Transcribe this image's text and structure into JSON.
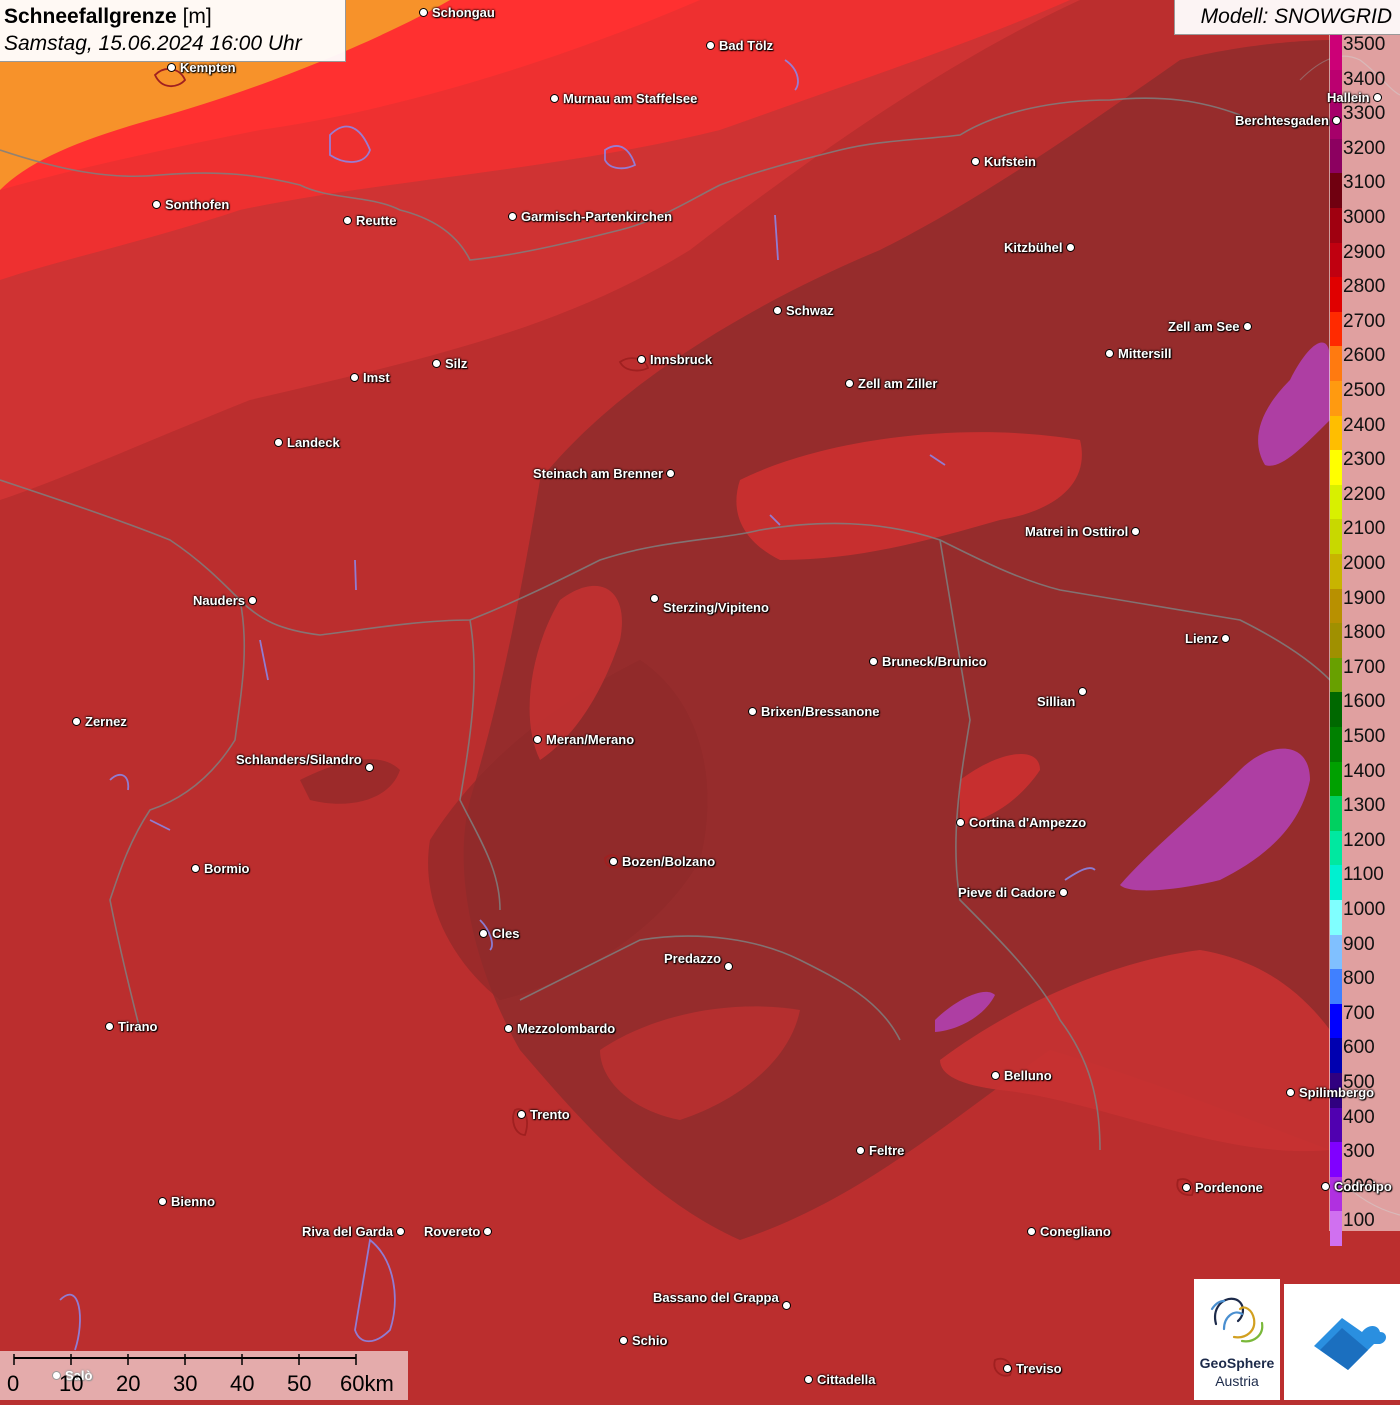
{
  "title": {
    "parameter": "Schneefallgrenze",
    "unit": "[m]",
    "datetime": "Samstag, 15.06.2024 16:00 Uhr"
  },
  "model": "Modell: SNOWGRID",
  "legend": {
    "levels": [
      {
        "label": "3500",
        "color": "#cc0077"
      },
      {
        "label": "3400",
        "color": "#bb0070"
      },
      {
        "label": "3300",
        "color": "#a6006a"
      },
      {
        "label": "3200",
        "color": "#8c0060"
      },
      {
        "label": "3100",
        "color": "#700010"
      },
      {
        "label": "3000",
        "color": "#a00010"
      },
      {
        "label": "2900",
        "color": "#c00010"
      },
      {
        "label": "2800",
        "color": "#e00000"
      },
      {
        "label": "2700",
        "color": "#ff2a00"
      },
      {
        "label": "2600",
        "color": "#ff7a10"
      },
      {
        "label": "2500",
        "color": "#ff9a10"
      },
      {
        "label": "2400",
        "color": "#ffbe00"
      },
      {
        "label": "2300",
        "color": "#ffff00"
      },
      {
        "label": "2200",
        "color": "#d8f000"
      },
      {
        "label": "2100",
        "color": "#c8d800"
      },
      {
        "label": "2000",
        "color": "#c8b400"
      },
      {
        "label": "1900",
        "color": "#b89000"
      },
      {
        "label": "1800",
        "color": "#a09000"
      },
      {
        "label": "1700",
        "color": "#68a000"
      },
      {
        "label": "1600",
        "color": "#006800"
      },
      {
        "label": "1500",
        "color": "#008000"
      },
      {
        "label": "1400",
        "color": "#00a000"
      },
      {
        "label": "1300",
        "color": "#00d060"
      },
      {
        "label": "1200",
        "color": "#00e8a0"
      },
      {
        "label": "1100",
        "color": "#00f0d0"
      },
      {
        "label": "1000",
        "color": "#80ffff"
      },
      {
        "label": "900",
        "color": "#80c0ff"
      },
      {
        "label": "800",
        "color": "#4080ff"
      },
      {
        "label": "700",
        "color": "#0000ff"
      },
      {
        "label": "600",
        "color": "#0000b0"
      },
      {
        "label": "500",
        "color": "#300080"
      },
      {
        "label": "400",
        "color": "#5000b0"
      },
      {
        "label": "300",
        "color": "#8000ff"
      },
      {
        "label": "200",
        "color": "#b030e0"
      },
      {
        "label": "100",
        "color": "#d070f0"
      }
    ]
  },
  "cities": [
    {
      "name": "Schongau"
    },
    {
      "name": "Bad Tölz"
    },
    {
      "name": "Kempten"
    },
    {
      "name": "Murnau am Staffelsee"
    },
    {
      "name": "Berchtesgaden"
    },
    {
      "name": "Hallein"
    },
    {
      "name": "Kufstein"
    },
    {
      "name": "Sonthofen"
    },
    {
      "name": "Reutte"
    },
    {
      "name": "Garmisch-Partenkirchen"
    },
    {
      "name": "Kitzbühel"
    },
    {
      "name": "Schwaz"
    },
    {
      "name": "Zell am See"
    },
    {
      "name": "Mittersill"
    },
    {
      "name": "Innsbruck"
    },
    {
      "name": "Imst"
    },
    {
      "name": "Silz"
    },
    {
      "name": "Zell am Ziller"
    },
    {
      "name": "Landeck"
    },
    {
      "name": "Steinach am Brenner"
    },
    {
      "name": "Matrei in Osttirol"
    },
    {
      "name": "Nauders"
    },
    {
      "name": "Sterzing/Vipiteno"
    },
    {
      "name": "Lienz"
    },
    {
      "name": "Bruneck/Brunico"
    },
    {
      "name": "Sillian"
    },
    {
      "name": "Zernez"
    },
    {
      "name": "Brixen/Bressanone"
    },
    {
      "name": "Meran/Merano"
    },
    {
      "name": "Schlanders/Silandro"
    },
    {
      "name": "Cortina d'Ampezzo"
    },
    {
      "name": "Bozen/Bolzano"
    },
    {
      "name": "Bormio"
    },
    {
      "name": "Pieve di Cadore"
    },
    {
      "name": "Cles"
    },
    {
      "name": "Predazzo"
    },
    {
      "name": "Tirano"
    },
    {
      "name": "Mezzolombardo"
    },
    {
      "name": "Belluno"
    },
    {
      "name": "Spilimbergo"
    },
    {
      "name": "Trento"
    },
    {
      "name": "Feltre"
    },
    {
      "name": "Pordenone"
    },
    {
      "name": "Codroipo"
    },
    {
      "name": "Bienno"
    },
    {
      "name": "Riva del Garda"
    },
    {
      "name": "Rovereto"
    },
    {
      "name": "Conegliano"
    },
    {
      "name": "Bassano del Grappa"
    },
    {
      "name": "Schio"
    },
    {
      "name": "Treviso"
    },
    {
      "name": "Cittadella"
    },
    {
      "name": "Salò"
    }
  ],
  "scalebar": {
    "ticks": [
      "0",
      "10",
      "20",
      "30",
      "40",
      "50",
      "60km"
    ]
  },
  "logos": {
    "geosphere_line1": "GeoSphere",
    "geosphere_line2": "Austria"
  }
}
